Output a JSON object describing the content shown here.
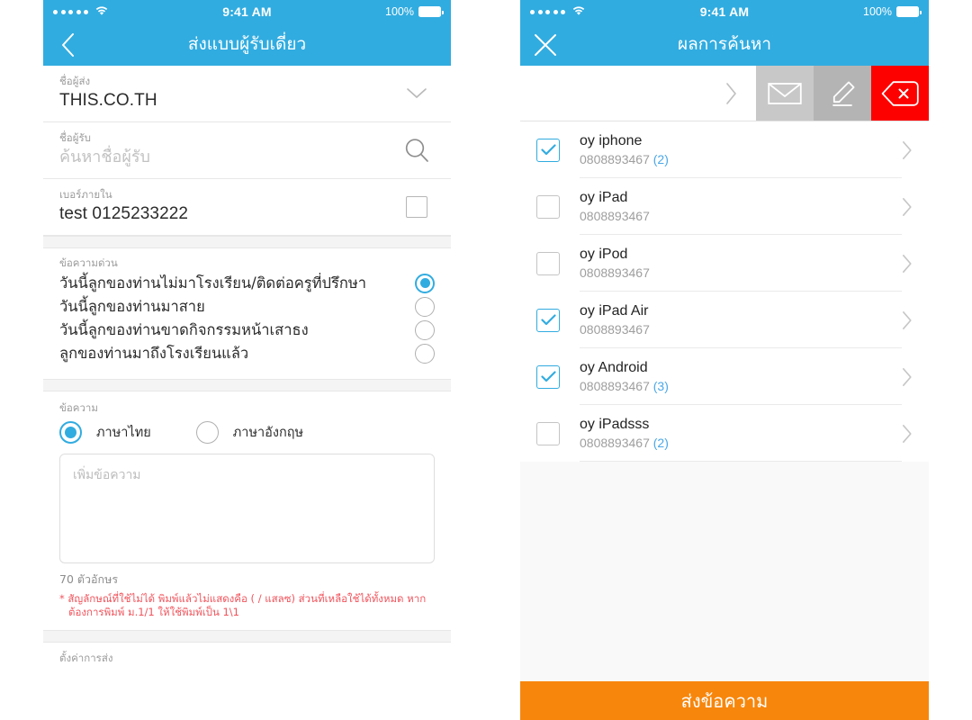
{
  "statusbar": {
    "time": "9:41 AM",
    "battery_label": "100%",
    "signal_icon": "signal-dots-icon",
    "wifi_icon": "wifi-icon",
    "battery_icon": "battery-full-icon"
  },
  "left_panel": {
    "nav": {
      "back_icon": "chevron-left-icon",
      "title": "ส่งแบบผู้รับเดี่ยว"
    },
    "fields": [
      {
        "label": "ชื่อผู้ส่ง",
        "value": "THIS.CO.TH",
        "accessory": "chevron-down-icon"
      },
      {
        "label": "ชื่อผู้รับ",
        "placeholder": "ค้นหาชื่อผู้รับ",
        "accessory": "search-icon"
      },
      {
        "label": "เบอร์ภายใน",
        "value": "test 0125233222",
        "accessory": "checkbox-unchecked-icon"
      }
    ],
    "urgent_group": {
      "label": "ข้อความด่วน",
      "options": [
        {
          "text": "วันนี้ลูกของท่านไม่มาโรงเรียน/ติดต่อครูที่ปรึกษา",
          "selected": true
        },
        {
          "text": "วันนี้ลูกของท่านมาสาย",
          "selected": false
        },
        {
          "text": "วันนี้ลูกของท่านขาดกิจกรรมหน้าเสาธง",
          "selected": false
        },
        {
          "text": "ลูกของท่านมาถึงโรงเรียนแล้ว",
          "selected": false
        }
      ]
    },
    "message_section": {
      "label": "ข้อความ",
      "languages": [
        {
          "text": "ภาษาไทย",
          "selected": true
        },
        {
          "text": "ภาษาอังกฤษ",
          "selected": false
        }
      ],
      "textarea_placeholder": "เพิ่มข้อความ",
      "char_count": "70 ตัวอักษร",
      "warning": "* สัญลักษณ์ที่ใช้ไม่ได้ พิมพ์แล้วไม่แสดงคือ ( / แสลซ) ส่วนที่เหลือใช้ได้ทั้งหมด หากต้องการพิมพ์ ม.1/1 ให้ใช้พิมพ์เป็น 1\\1"
    },
    "footer_section": {
      "label": "ตั้งค่าการส่ง"
    }
  },
  "right_panel": {
    "nav": {
      "close_icon": "close-x-icon",
      "title": "ผลการค้นหา"
    },
    "toolbar": {
      "expand_icon": "chevron-right-icon",
      "buttons": [
        {
          "icon": "envelope-icon",
          "color": "#c8c8c8"
        },
        {
          "icon": "pencil-edit-icon",
          "color": "#b4b4b4"
        },
        {
          "icon": "delete-backspace-icon",
          "color": "#fd0000"
        }
      ]
    },
    "contacts": [
      {
        "name": "oy iphone",
        "phone": "0808893467",
        "count": "(2)",
        "checked": true,
        "arrow": "chevron-right-icon"
      },
      {
        "name": "oy iPad",
        "phone": "0808893467",
        "count": "",
        "checked": false,
        "arrow": "chevron-right-icon"
      },
      {
        "name": "oy iPod",
        "phone": "0808893467",
        "count": "",
        "checked": false,
        "arrow": "chevron-right-icon"
      },
      {
        "name": "oy iPad Air",
        "phone": "0808893467",
        "count": "",
        "checked": true,
        "arrow": "chevron-right-icon"
      },
      {
        "name": "oy Android",
        "phone": "0808893467",
        "count": "(3)",
        "checked": true,
        "arrow": "chevron-right-icon"
      },
      {
        "name": "oy iPadsss",
        "phone": "0808893467",
        "count": "(2)",
        "checked": false,
        "arrow": "chevron-right-icon"
      }
    ],
    "send_button": "ส่งข้อความ"
  },
  "colors": {
    "brand_blue": "#31ace0",
    "accent_orange": "#f7860c",
    "danger_red": "#fd0000",
    "link_blue": "#4aa8e8",
    "warning_red": "#f0545c"
  }
}
